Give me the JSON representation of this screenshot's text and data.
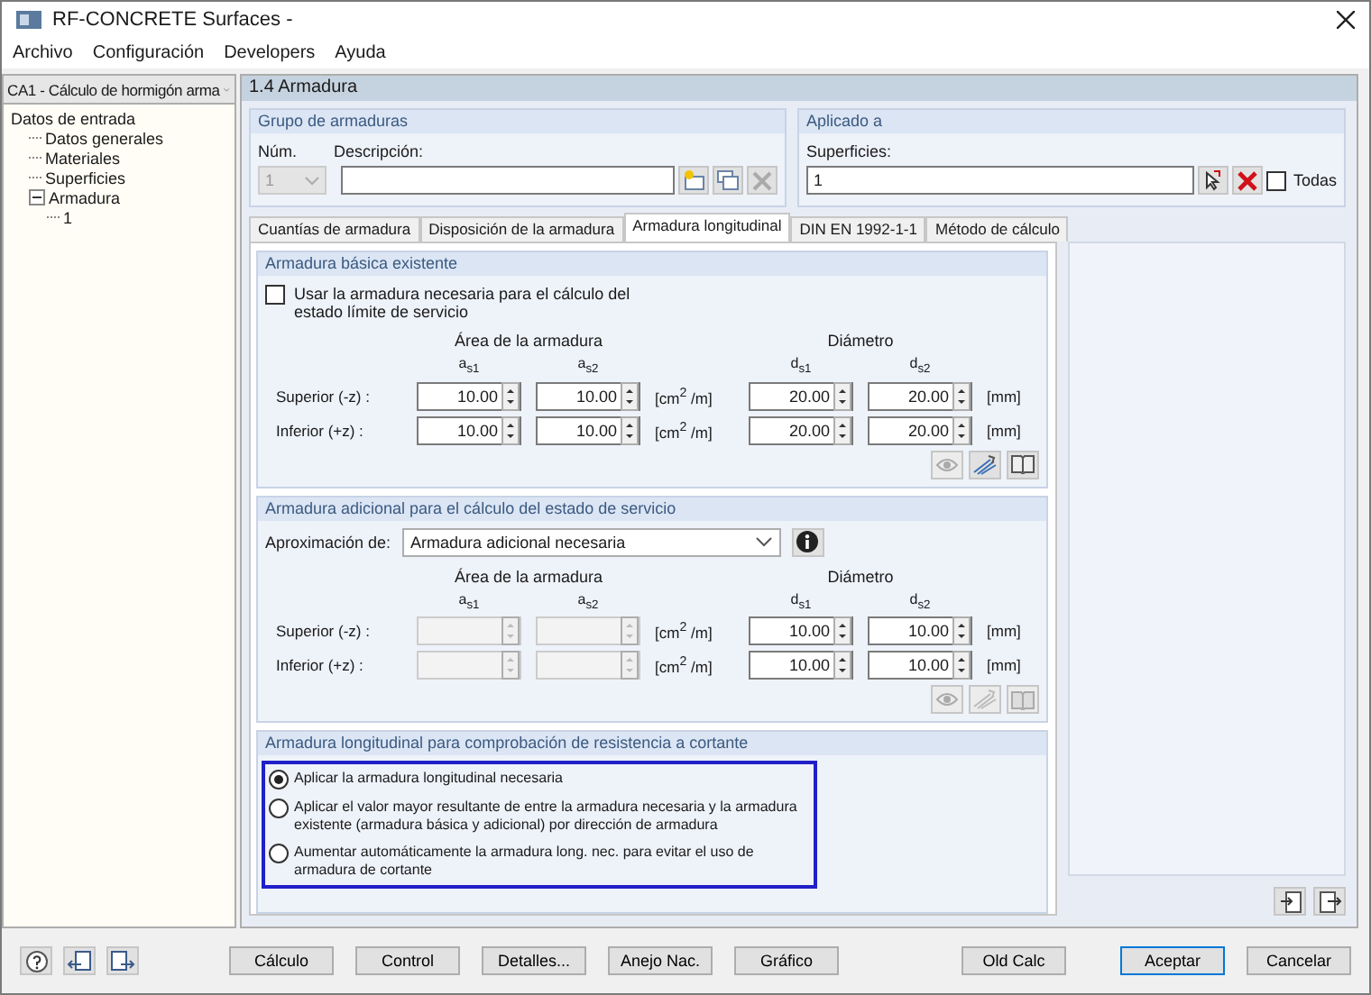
{
  "window": {
    "title": "RF-CONCRETE Surfaces -"
  },
  "menu": [
    "Archivo",
    "Configuración",
    "Developers",
    "Ayuda"
  ],
  "case_select": {
    "value": "CA1 - Cálculo de hormigón arma"
  },
  "tree": [
    {
      "label": "Datos de entrada",
      "children": [
        {
          "label": "Datos generales"
        },
        {
          "label": "Materiales"
        },
        {
          "label": "Superficies"
        },
        {
          "label": "Armadura",
          "expanded": true,
          "children": [
            {
              "label": "1"
            }
          ]
        }
      ]
    }
  ],
  "section_title": "1.4 Armadura",
  "group": {
    "title": "Grupo de armaduras",
    "num_label": "Núm.",
    "num_value": "1",
    "description_label": "Descripción:"
  },
  "applied_to": {
    "title": "Aplicado a",
    "surfaces_label": "Superficies:",
    "surfaces_value": "1",
    "all_label": "Todas",
    "all_checked": false
  },
  "tabs": [
    {
      "label": "Cuantías de armadura",
      "selected": false
    },
    {
      "label": "Disposición de la armadura",
      "selected": false
    },
    {
      "label": "Armadura longitudinal",
      "selected": true
    },
    {
      "label": "DIN EN 1992-1-1",
      "selected": false
    },
    {
      "label": "Método de cálculo",
      "selected": false
    }
  ],
  "basic": {
    "title": "Armadura básica existente",
    "use_required": {
      "label": "Usar la armadura necesaria para el cálculo del estado límite de servicio",
      "checked": false
    },
    "area_header": "Área de la armadura",
    "diameter_header": "Diámetro",
    "columns": [
      "a$_{s1}$",
      "a$_{s2}$",
      "d$_{s1}$",
      "d$_{s2}$"
    ],
    "rows": [
      {
        "label": "Superior (-z) :",
        "area_unit": "[cm$^{2}$ /m]",
        "diameter_unit": "[mm]",
        "cells": [
          {
            "value": "10.00",
            "disabled": false
          },
          {
            "value": "10.00",
            "disabled": false
          },
          {
            "value": "20.00",
            "disabled": false
          },
          {
            "value": "20.00",
            "disabled": false
          }
        ]
      },
      {
        "label": "Inferior (+z) :",
        "area_unit": "[cm$^{2}$ /m]",
        "diameter_unit": "[mm]",
        "cells": [
          {
            "value": "10.00",
            "disabled": false
          },
          {
            "value": "10.00",
            "disabled": false
          },
          {
            "value": "20.00",
            "disabled": false
          },
          {
            "value": "20.00",
            "disabled": false
          }
        ]
      }
    ],
    "tools_disabled": [
      true,
      false,
      false
    ]
  },
  "additional": {
    "title": "Armadura adicional para el cálculo del estado de servicio",
    "approx_label": "Aproximación de:",
    "approx_value": "Armadura adicional necesaria",
    "area_header": "Área de la armadura",
    "diameter_header": "Diámetro",
    "columns": [
      "a$_{s1}$",
      "a$_{s2}$",
      "d$_{s1}$",
      "d$_{s2}$"
    ],
    "rows": [
      {
        "label": "Superior (-z) :",
        "area_unit": "[cm$^{2}$ /m]",
        "diameter_unit": "[mm]",
        "cells": [
          {
            "disabled": true
          },
          {
            "disabled": true
          },
          {
            "value": "10.00",
            "disabled": false
          },
          {
            "value": "10.00",
            "disabled": false
          }
        ]
      },
      {
        "label": "Inferior (+z) :",
        "area_unit": "[cm$^{2}$ /m]",
        "diameter_unit": "[mm]",
        "cells": [
          {
            "disabled": true
          },
          {
            "disabled": true
          },
          {
            "value": "10.00",
            "disabled": false
          },
          {
            "value": "10.00",
            "disabled": false
          }
        ]
      }
    ],
    "tools_disabled": [
      true,
      true,
      true
    ]
  },
  "shear": {
    "title": "Armadura longitudinal para comprobación de resistencia a cortante",
    "options": [
      {
        "label": "Aplicar la armadura longitudinal necesaria",
        "selected": true
      },
      {
        "label": "Aplicar el valor mayor resultante de entre la armadura necesaria y la armadura existente (armadura básica y adicional) por dirección de armadura",
        "selected": false
      },
      {
        "label": "Aumentar automáticamente la armadura long. nec. para evitar el uso de armadura de cortante",
        "selected": false
      }
    ]
  },
  "buttons": [
    {
      "label": "Cálculo",
      "kind": "normal"
    },
    {
      "label": "Control",
      "kind": "normal"
    },
    {
      "label": "Detalles...",
      "kind": "normal"
    },
    {
      "label": "Anejo Nac.",
      "kind": "normal"
    },
    {
      "label": "Gráfico",
      "kind": "normal"
    },
    {
      "label": "Old Calc",
      "kind": "gap"
    },
    {
      "label": "Aceptar",
      "kind": "default"
    },
    {
      "label": "Cancelar",
      "kind": "normal"
    }
  ]
}
